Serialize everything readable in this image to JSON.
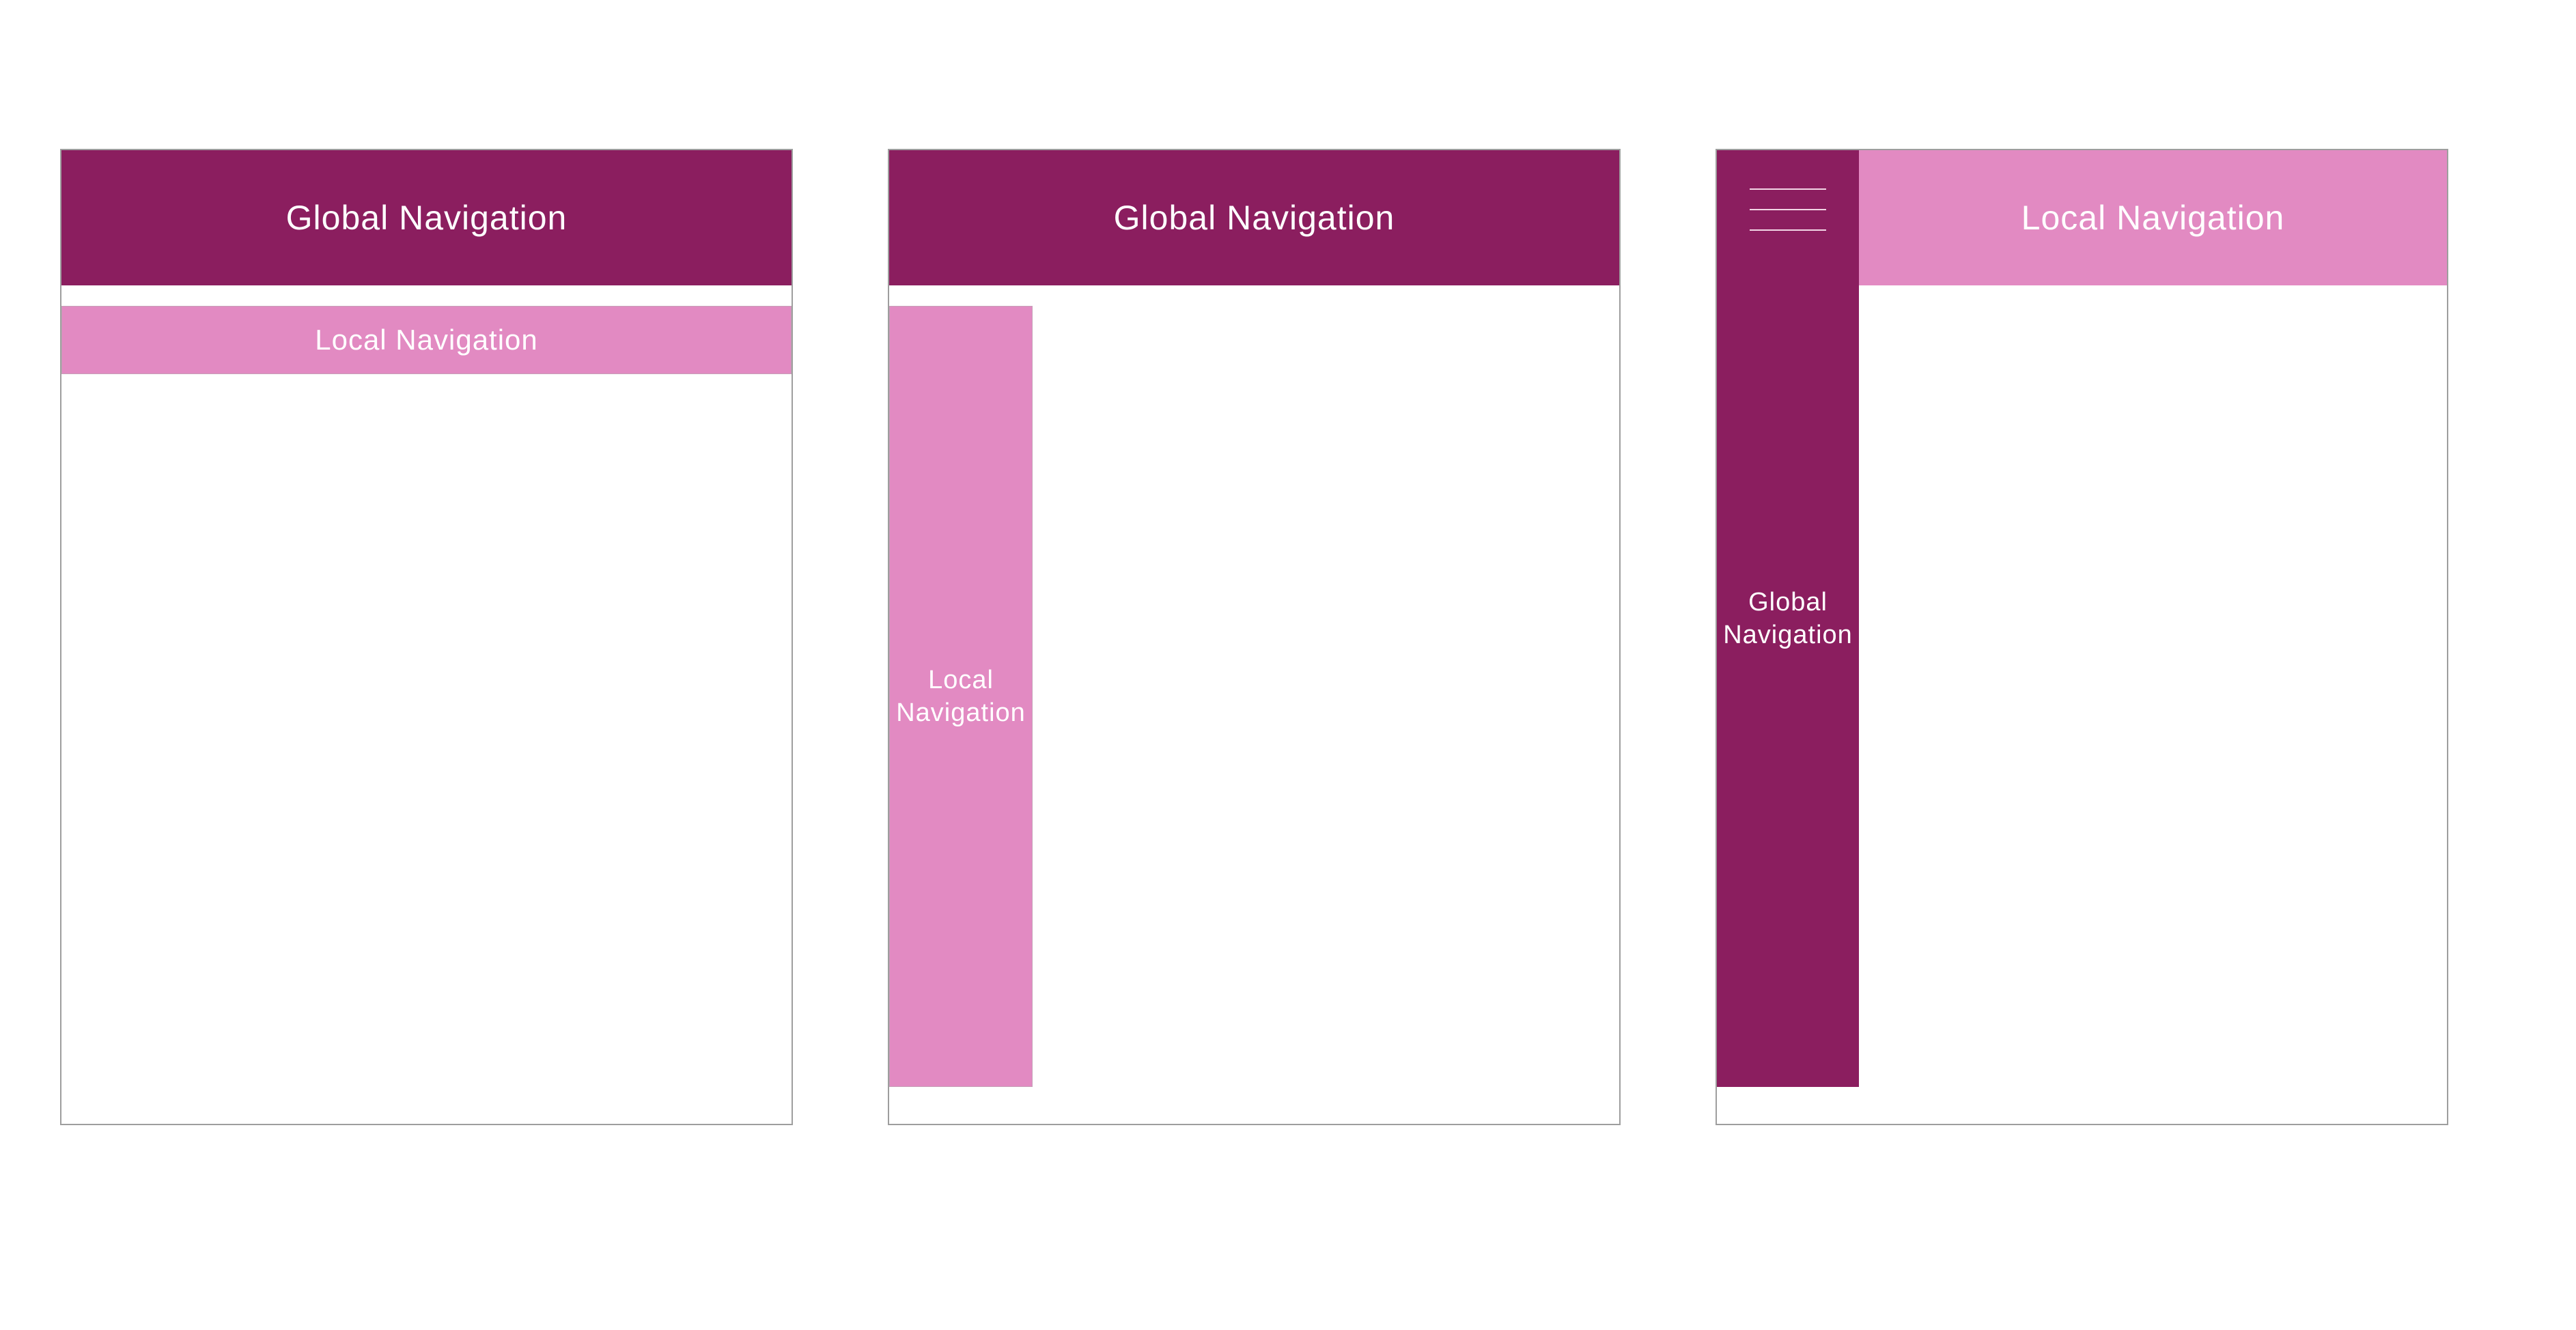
{
  "colors": {
    "global_nav": "#8b1e5f",
    "local_nav": "#e28ac2",
    "frame_border": "#9e9e9e",
    "text": "#ffffff"
  },
  "wireframes": [
    {
      "global_nav": {
        "label": "Global Navigation"
      },
      "local_nav": {
        "label": "Local Navigation"
      }
    },
    {
      "global_nav": {
        "label": "Global Navigation"
      },
      "local_nav": {
        "label": "Local\nNavigation"
      }
    },
    {
      "menu_icon": "hamburger-icon",
      "global_nav": {
        "label": "Global\nNavigation"
      },
      "local_nav": {
        "label": "Local Navigation"
      }
    }
  ]
}
